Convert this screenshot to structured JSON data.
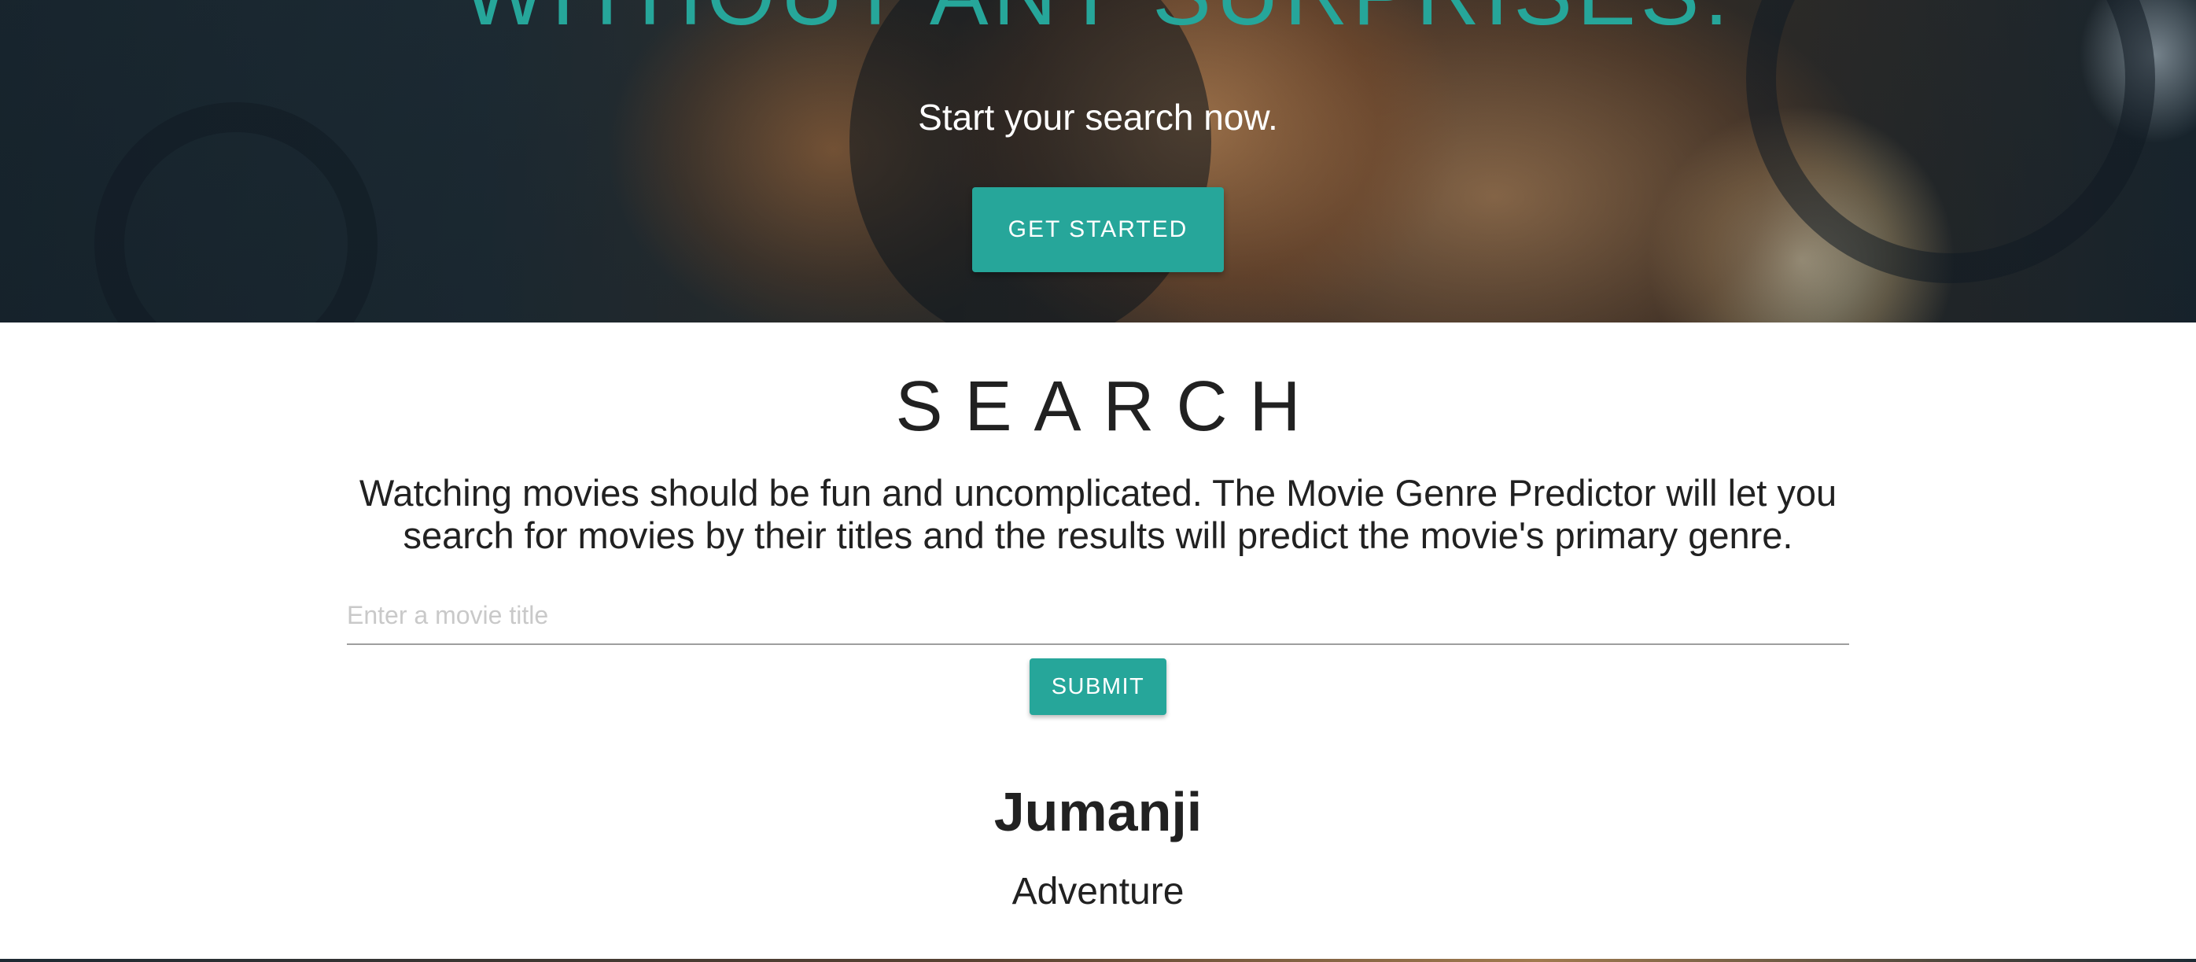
{
  "hero": {
    "heading": "WITHOUT ANY SURPRISES.",
    "subheading": "Start your search now.",
    "cta_label": "GET STARTED"
  },
  "search": {
    "title": "SEARCH",
    "description": "Watching movies should be fun and uncomplicated. The Movie Genre Predictor will let you search for movies by their titles and the results will predict the movie's primary genre.",
    "input_value": "",
    "input_placeholder": "Enter a movie title",
    "submit_label": "SUBMIT"
  },
  "result": {
    "movie_title": "Jumanji",
    "genre": "Adventure"
  },
  "colors": {
    "accent": "#26a69a",
    "text": "#212121",
    "placeholder": "#c9c9c9"
  }
}
